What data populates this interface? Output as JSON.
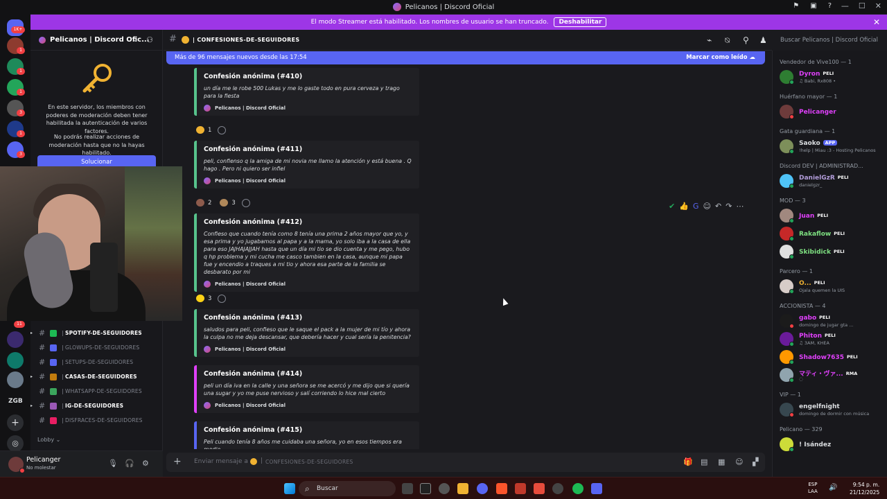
{
  "window": {
    "title": "Pelicanos | Discord Oficial",
    "controls": [
      "—",
      "☐",
      "✕"
    ]
  },
  "banner": {
    "text": "El modo Streamer está habilitado. Los nombres de usuario se han truncado.",
    "button": "Deshabilitar"
  },
  "rail": {
    "badges": [
      "1K+",
      "1",
      "1",
      "1",
      "3",
      "1",
      "3",
      "1",
      "11"
    ],
    "text_server": "ZGB"
  },
  "server": {
    "name": "Pelicanos | Discord Ofic...",
    "mfa_text_1": "En este servidor, los miembros con poderes de moderación deben tener habilitada la autenticación de varios factores.",
    "mfa_text_2": "No podrás realizar acciones de moderación hasta que no la hayas habilitado.",
    "solve_button": "Solucionar",
    "channels": [
      {
        "name": "SPOTIFY-DE-SEGUIDORES",
        "bold": true,
        "arrow": true,
        "color": "#1db954"
      },
      {
        "name": "GLOWUPS-DE-SEGUIDORES",
        "bold": false,
        "arrow": false,
        "color": "#5865f2"
      },
      {
        "name": "SETUPS-DE-SEGUIDORES",
        "bold": false,
        "arrow": false,
        "color": "#5865f2"
      },
      {
        "name": "CASAS-DE-SEGUIDORES",
        "bold": true,
        "arrow": true,
        "color": "#c27c0e"
      },
      {
        "name": "WHATSAPP-DE-SEGUIDORES",
        "bold": false,
        "arrow": false,
        "color": "#3ba55c"
      },
      {
        "name": "IG-DE-SEGUIDORES",
        "bold": true,
        "arrow": true,
        "color": "#9b59b6"
      },
      {
        "name": "DISFRACES-DE-SEGUIDORES",
        "bold": false,
        "arrow": false,
        "color": "#e91e63"
      }
    ],
    "lobby": "Lobby"
  },
  "user": {
    "name": "Pelicanger",
    "status": "No molestar"
  },
  "chat": {
    "channel": "CONFESIONES-DE-SEGUIDORES",
    "new_messages": "Más de 96 mensajes nuevos desde las 17:54",
    "mark_read": "Marcar como leído",
    "author_footer": "Pelicanos | Discord Oficial",
    "messages": [
      {
        "title": "Confesión anónima (#410)",
        "body": "un día me le robe 500 Lukas y me lo gaste todo en pura cerveza y trago para la fiesta",
        "reactions": [
          {
            "emoji": "😂",
            "count": "1",
            "color": "#f0b232"
          }
        ]
      },
      {
        "title": "Confesión anónima (#411)",
        "body": "peli, confienso q la amiga de mi novia me llamo la atención y está buena . Q hago . Pero ni quiero ser infiel",
        "reactions": [
          {
            "emoji": "sticker",
            "count": "2",
            "color": "#8d5b4c"
          },
          {
            "emoji": "sticker2",
            "count": "3",
            "color": "#b0885a"
          }
        ]
      },
      {
        "title": "Confesión anónima (#412)",
        "body": "Confieso que cuando tenía como 8 tenía una prima 2 años mayor que yo, y esa prima y yo jugabamos al papa y a la mama, yo solo iba a la casa de ella para eso JAJHAJAJJAH hasta que un día mi tio se dio cuenta y me pego, hubo q hp problema y mi cucha me casco tambien en la casa, aunque mi papa fue y encendio a traques a mi tio y ahora esa parte de la familia se desbarato por mi",
        "reactions": [
          {
            "emoji": "flag",
            "count": "3",
            "color": "#fcd116"
          }
        ]
      },
      {
        "title": "Confesión anónima (#413)",
        "body": "saludos para peli, confieso que le saque el pack a la mujer de mi tío y ahora la culpa no me deja descansar, que debería hacer y cual sería la penitencia?",
        "reactions": []
      },
      {
        "title": "Confesión anónima (#414)",
        "body": "peli un día iva en la calle y una señora se me acercó y me dijo que si quería una sugar y yo me puse nervioso y salí corriendo lo hice mal cierto",
        "reactions": []
      },
      {
        "title": "Confesión anónima (#415)",
        "body": "Peli cuando tenía 8 años me cuidaba una señora, yo en esos tiempos era medio",
        "reactions": []
      }
    ],
    "composer_placeholder": "Enviar mensaje a #",
    "composer_channel": "CONFESIONES-DE-SEGUIDORES"
  },
  "search": {
    "placeholder": "Buscar Pelicanos | Discord Oficial"
  },
  "members": {
    "groups": [
      {
        "role": "Vendedor de Vive100 — 1",
        "members": [
          {
            "name": "Dyron",
            "tag": "PELI",
            "status": "♫ Babi, Rx808 •",
            "color": "#e040fb",
            "avatar": "#2e7d32",
            "online": "#23a55a"
          }
        ]
      },
      {
        "role": "Huérfano mayor — 1",
        "members": [
          {
            "name": "Pelicanger",
            "tag": "",
            "status": "",
            "color": "#e040fb",
            "avatar": "#6e3b3b",
            "online": "#f23f43"
          }
        ]
      },
      {
        "role": "Gata guardiana — 1",
        "members": [
          {
            "name": "Saoko",
            "tag": "APP",
            "status": "!help | Miau :3 - Hosting Pelicanos",
            "color": "#dbdee1",
            "avatar": "#7d8f5a",
            "online": "#23a55a"
          }
        ]
      },
      {
        "role": "Discord DEV | ADMINISTRAD...",
        "members": [
          {
            "name": "DanielGzR",
            "tag": "PELI",
            "status": "danielgzr_",
            "color": "#b39ddb",
            "avatar": "#4fc3f7",
            "online": "#23a55a"
          }
        ]
      },
      {
        "role": "MOD — 3",
        "members": [
          {
            "name": "Juan",
            "tag": "PELI",
            "status": "",
            "color": "#e040fb",
            "avatar": "#a1887f",
            "online": "#23a55a"
          },
          {
            "name": "Rakaflow",
            "tag": "PELI",
            "status": "",
            "color": "#7ee081",
            "avatar": "#c62828",
            "online": "#23a55a"
          },
          {
            "name": "Skibidick",
            "tag": "PELI",
            "status": "",
            "color": "#7ee081",
            "avatar": "#e0e0e0",
            "online": "#23a55a"
          }
        ]
      },
      {
        "role": "Parcero — 1",
        "members": [
          {
            "name": "O...",
            "tag": "PELI",
            "status": "Ojala quemen la UIS",
            "color": "#f0b232",
            "avatar": "#d7ccc8",
            "online": "#23a55a"
          }
        ]
      },
      {
        "role": "ACCIONISTA — 4",
        "members": [
          {
            "name": "gabo",
            "tag": "PELI",
            "status": "domingo de jugar gta ...",
            "color": "#e040fb",
            "avatar": "#1b1b1b",
            "online": "#f23f43"
          },
          {
            "name": "Phiton",
            "tag": "PELI",
            "status": "♫ 3AM, KHEA",
            "color": "#e040fb",
            "avatar": "#6a1b9a",
            "online": "#23a55a"
          },
          {
            "name": "Shadow7635",
            "tag": "PELI",
            "status": "",
            "color": "#e040fb",
            "avatar": "#ff9800",
            "online": "#23a55a"
          },
          {
            "name": "マティ・ヴァ...",
            "tag": "RMA",
            "status": "◌",
            "color": "#e040fb",
            "avatar": "#90a4ae",
            "online": "#23a55a"
          }
        ]
      },
      {
        "role": "VIP — 1",
        "members": [
          {
            "name": "engelfnight",
            "tag": "",
            "status": "domingo de dormir con música",
            "color": "#dbdee1",
            "avatar": "#37474f",
            "online": "#f23f43"
          }
        ]
      },
      {
        "role": "Pelicano — 329",
        "members": [
          {
            "name": "! Isández",
            "tag": "",
            "status": "",
            "color": "#dbdee1",
            "avatar": "#cddc39",
            "online": "#23a55a"
          }
        ]
      }
    ]
  },
  "taskbar": {
    "search": "Buscar",
    "lang_1": "ESP",
    "lang_2": "LAA",
    "time": "9:54 p. m.",
    "date": "21/12/2025"
  }
}
